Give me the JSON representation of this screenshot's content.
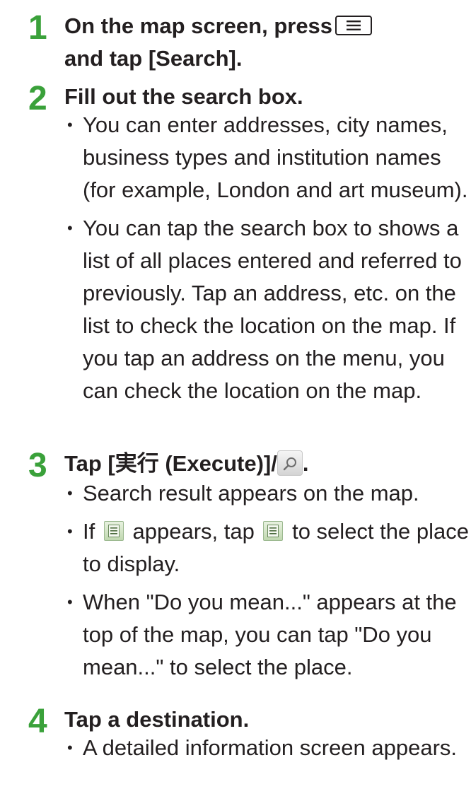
{
  "steps": [
    {
      "number": "1",
      "title_lines": [
        "On the map screen, press",
        "and tap [Search]."
      ],
      "icon": "menu-key-icon",
      "bullets": []
    },
    {
      "number": "2",
      "title": "Fill out the search box.",
      "bullets": [
        "You can enter addresses, city names, business types and institution names (for example, London and art museum).",
        "You can tap the search box to shows a list of all places entered and referred to previously. Tap an address, etc. on the list to check the location on the map. If you tap an address on the menu, you can check the location on the map."
      ]
    },
    {
      "number": "3",
      "title_prefix": "Tap [実行 (Execute)]/",
      "title_suffix": ".",
      "icon": "search-icon",
      "bullets": [
        "Search result appears on the map.",
        {
          "before": "If",
          "middle": "appears, tap",
          "after": "to select the place to display.",
          "icon": "list-icon"
        },
        "When \"Do you mean...\" appears at the top of the map, you can tap \"Do you mean...\" to select the place."
      ]
    },
    {
      "number": "4",
      "title": "Tap a destination.",
      "bullets": [
        "A detailed information screen appears."
      ]
    }
  ],
  "colors": {
    "step_number": "#3aa13a",
    "text": "#231f20"
  }
}
